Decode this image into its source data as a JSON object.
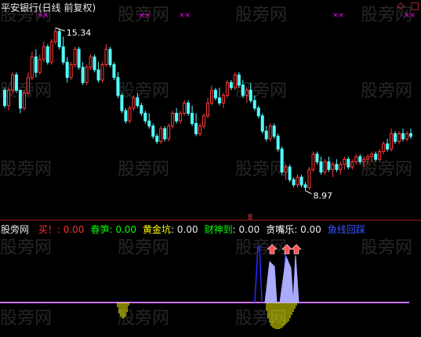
{
  "header": {
    "title": "平安银行(日线 前复权)",
    "corner_glyphs": [
      "◇",
      "□"
    ]
  },
  "watermark": "股旁网",
  "price_panel": {
    "high_label": "15.34",
    "low_label": "8.97",
    "signal_glyph": "8",
    "cross_glyph": "××"
  },
  "legend": {
    "name": "股旁网",
    "items": [
      {
        "label": "买！",
        "value": "0.00",
        "label_color": "#ff3030",
        "value_color": "#ff3030"
      },
      {
        "label": "春笋",
        "value": "0.00",
        "label_color": "#00ff00",
        "value_color": "#00ff00"
      },
      {
        "label": "黄金坑",
        "value": "0.00",
        "label_color": "#ffff00",
        "value_color": "#e8e8e8"
      },
      {
        "label": "财神到",
        "value": "0.00",
        "label_color": "#00ff00",
        "value_color": "#e8e8e8"
      },
      {
        "label": "贪嘴乐",
        "value": "0.00",
        "label_color": "#ffffff",
        "value_color": "#e8e8e8"
      },
      {
        "label": "鱼线回踩",
        "value": "",
        "label_color": "#3355ff",
        "value_color": "#3355ff"
      }
    ]
  },
  "colors": {
    "up": "#ff3b3b",
    "down": "#54ffff",
    "axis": "#b22222",
    "baseline": "#d070ff",
    "yellow": "#ffff00",
    "blue": "#2a2aff",
    "lavender": "#aaaaff",
    "arrow": "#ff5050",
    "cross": "#ff00ff"
  },
  "chart_data": [
    {
      "type": "candlestick",
      "title": "平安银行(日线 前复权)",
      "ylim": [
        8.0,
        16.0
      ],
      "annotations": [
        {
          "label": "15.34",
          "kind": "high",
          "value": 15.34
        },
        {
          "label": "8.97",
          "kind": "low",
          "value": 8.97
        }
      ],
      "ohlc": [
        [
          12.9,
          13.0,
          12.2,
          12.3
        ],
        [
          12.3,
          13.0,
          12.1,
          12.9
        ],
        [
          12.9,
          13.6,
          12.8,
          13.5
        ],
        [
          13.5,
          13.6,
          12.8,
          12.9
        ],
        [
          12.9,
          12.9,
          12.0,
          12.2
        ],
        [
          12.2,
          12.9,
          12.1,
          12.8
        ],
        [
          12.8,
          13.6,
          12.7,
          13.4
        ],
        [
          13.4,
          14.4,
          13.3,
          14.2
        ],
        [
          14.2,
          14.5,
          13.4,
          13.6
        ],
        [
          13.6,
          14.3,
          13.5,
          14.1
        ],
        [
          14.1,
          14.8,
          14.0,
          14.6
        ],
        [
          14.6,
          14.7,
          13.9,
          14.0
        ],
        [
          14.0,
          14.9,
          13.9,
          14.8
        ],
        [
          14.8,
          15.34,
          14.7,
          15.2
        ],
        [
          15.2,
          15.3,
          14.5,
          14.6
        ],
        [
          14.6,
          15.0,
          13.9,
          14.0
        ],
        [
          14.0,
          14.2,
          13.2,
          13.4
        ],
        [
          13.4,
          14.0,
          13.3,
          13.9
        ],
        [
          13.9,
          14.6,
          13.8,
          14.5
        ],
        [
          14.5,
          14.6,
          13.7,
          13.8
        ],
        [
          13.8,
          14.0,
          13.1,
          13.2
        ],
        [
          13.2,
          13.9,
          13.1,
          13.8
        ],
        [
          13.8,
          14.3,
          13.7,
          14.2
        ],
        [
          14.2,
          14.3,
          13.6,
          13.7
        ],
        [
          13.7,
          14.0,
          13.2,
          13.3
        ],
        [
          13.3,
          14.0,
          13.2,
          13.9
        ],
        [
          13.9,
          14.7,
          13.8,
          14.5
        ],
        [
          14.5,
          14.6,
          13.8,
          13.9
        ],
        [
          13.9,
          14.0,
          13.3,
          13.4
        ],
        [
          13.4,
          13.6,
          12.6,
          12.7
        ],
        [
          12.7,
          12.8,
          12.0,
          12.1
        ],
        [
          12.1,
          12.2,
          11.6,
          11.7
        ],
        [
          11.7,
          12.3,
          11.6,
          12.2
        ],
        [
          12.2,
          12.7,
          12.1,
          12.6
        ],
        [
          12.6,
          12.8,
          12.2,
          12.3
        ],
        [
          12.3,
          12.4,
          11.9,
          12.0
        ],
        [
          12.0,
          12.1,
          11.6,
          11.7
        ],
        [
          11.7,
          12.0,
          11.4,
          11.5
        ],
        [
          11.5,
          11.6,
          11.0,
          11.1
        ],
        [
          11.1,
          11.2,
          10.8,
          10.9
        ],
        [
          10.9,
          11.5,
          10.8,
          11.4
        ],
        [
          11.4,
          11.5,
          10.9,
          11.0
        ],
        [
          11.0,
          11.6,
          10.9,
          11.5
        ],
        [
          11.5,
          12.1,
          11.4,
          12.0
        ],
        [
          12.0,
          12.2,
          11.6,
          11.7
        ],
        [
          11.7,
          12.1,
          11.6,
          12.0
        ],
        [
          12.0,
          12.5,
          11.9,
          12.4
        ],
        [
          12.4,
          12.5,
          11.9,
          12.0
        ],
        [
          12.0,
          12.3,
          11.5,
          11.6
        ],
        [
          11.6,
          12.0,
          11.1,
          11.2
        ],
        [
          11.2,
          11.6,
          11.1,
          11.5
        ],
        [
          11.5,
          12.0,
          11.4,
          11.9
        ],
        [
          11.9,
          12.6,
          11.8,
          12.4
        ],
        [
          12.4,
          13.1,
          12.3,
          12.9
        ],
        [
          12.9,
          13.0,
          12.5,
          12.6
        ],
        [
          12.6,
          13.0,
          12.3,
          12.4
        ],
        [
          12.4,
          12.8,
          12.2,
          12.7
        ],
        [
          12.7,
          13.3,
          12.6,
          13.2
        ],
        [
          13.2,
          13.3,
          12.9,
          13.0
        ],
        [
          13.0,
          13.6,
          12.9,
          13.5
        ],
        [
          13.5,
          13.6,
          13.0,
          13.1
        ],
        [
          13.1,
          13.3,
          12.6,
          12.7
        ],
        [
          12.7,
          13.0,
          12.4,
          12.9
        ],
        [
          12.9,
          13.2,
          12.4,
          12.5
        ],
        [
          12.5,
          12.7,
          12.1,
          12.2
        ],
        [
          12.2,
          12.3,
          11.8,
          11.9
        ],
        [
          11.9,
          12.0,
          11.2,
          11.3
        ],
        [
          11.3,
          11.5,
          10.9,
          11.0
        ],
        [
          11.0,
          11.6,
          10.9,
          11.5
        ],
        [
          11.5,
          11.6,
          11.0,
          11.1
        ],
        [
          11.1,
          11.2,
          10.5,
          10.6
        ],
        [
          10.6,
          10.7,
          9.6,
          9.7
        ],
        [
          9.7,
          10.0,
          9.4,
          9.9
        ],
        [
          9.9,
          10.0,
          9.3,
          9.4
        ],
        [
          9.4,
          9.5,
          9.1,
          9.2
        ],
        [
          9.2,
          9.6,
          9.1,
          9.5
        ],
        [
          9.5,
          9.6,
          9.1,
          9.2
        ],
        [
          9.2,
          9.3,
          8.97,
          9.1
        ],
        [
          9.1,
          9.9,
          9.0,
          9.8
        ],
        [
          9.8,
          10.5,
          9.7,
          10.4
        ],
        [
          10.4,
          10.5,
          10.0,
          10.1
        ],
        [
          10.1,
          10.3,
          9.6,
          9.7
        ],
        [
          9.7,
          10.2,
          9.6,
          10.1
        ],
        [
          10.1,
          10.3,
          9.7,
          9.8
        ],
        [
          9.8,
          10.1,
          9.5,
          10.0
        ],
        [
          10.0,
          10.2,
          9.7,
          9.8
        ],
        [
          9.8,
          10.1,
          9.6,
          10.0
        ],
        [
          10.0,
          10.3,
          9.8,
          10.2
        ],
        [
          10.2,
          10.3,
          9.8,
          9.9
        ],
        [
          9.9,
          10.2,
          9.8,
          10.1
        ],
        [
          10.1,
          10.4,
          10.0,
          10.3
        ],
        [
          10.3,
          10.4,
          10.0,
          10.1
        ],
        [
          10.1,
          10.3,
          9.9,
          10.2
        ],
        [
          10.2,
          10.4,
          10.0,
          10.3
        ],
        [
          10.3,
          10.5,
          10.1,
          10.4
        ],
        [
          10.4,
          10.5,
          10.1,
          10.2
        ],
        [
          10.2,
          10.6,
          10.1,
          10.5
        ],
        [
          10.5,
          10.9,
          10.4,
          10.8
        ],
        [
          10.8,
          11.0,
          10.5,
          10.6
        ],
        [
          10.6,
          11.4,
          10.5,
          11.2
        ],
        [
          11.2,
          11.3,
          10.8,
          10.9
        ],
        [
          10.9,
          11.3,
          10.8,
          11.2
        ],
        [
          11.2,
          11.4,
          10.9,
          11.0
        ],
        [
          11.0,
          11.3,
          10.9,
          11.2
        ],
        [
          11.2,
          11.4,
          11.0,
          11.1
        ]
      ]
    },
    {
      "type": "line",
      "series": [
        {
          "name": "黄金坑",
          "values": [
            {
              "x": 0.28,
              "y": -1.0
            },
            {
              "x": 0.305,
              "y": -0.4
            }
          ]
        },
        {
          "name": "鱼线回踩",
          "values": [
            {
              "x": 0.615,
              "y": 1.0
            },
            {
              "x": 0.7,
              "y": 1.0
            }
          ]
        },
        {
          "name": "贪嘴乐",
          "values": [
            {
              "x": 0.64,
              "y": 0.7
            },
            {
              "x": 0.695,
              "y": 0.75
            }
          ]
        }
      ]
    }
  ]
}
